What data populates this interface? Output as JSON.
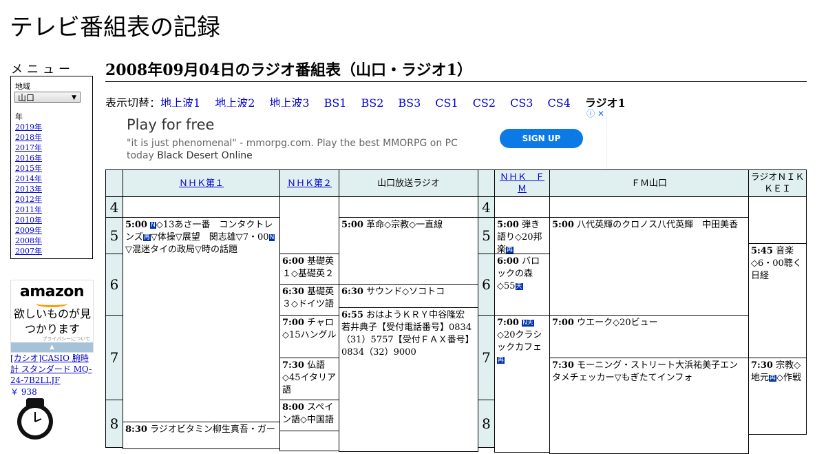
{
  "site_title": "テレビ番組表の記録",
  "menu": {
    "title": "メニュー",
    "region_label": "地域",
    "region_value": "山口",
    "year_label": "年",
    "years": [
      "2019年",
      "2018年",
      "2017年",
      "2016年",
      "2015年",
      "2014年",
      "2013年",
      "2012年",
      "2011年",
      "2010年",
      "2009年",
      "2008年",
      "2007年"
    ]
  },
  "amazon": {
    "logo": "amazon",
    "tagline": "欲しいものが見つかります",
    "privacy": "プライバシーについて",
    "product_title": "[カシオ]CASIO 腕時計 スタンダード MQ-24-7B2LLJF",
    "price": "￥ 938"
  },
  "page_heading": "2008年09月04日のラジオ番組表（山口・ラジオ1）",
  "switcher": {
    "label": "表示切替：",
    "links": [
      "地上波1",
      "地上波2",
      "地上波3",
      "BS1",
      "BS2",
      "BS3",
      "CS1",
      "CS2",
      "CS3",
      "CS4"
    ],
    "current": "ラジオ1"
  },
  "ad": {
    "title": "Play for free",
    "desc": "\"it is just phenomenal\" - mmorpg.com. Play the best MMORPG on PC today",
    "desc_bold": "Black Desert Online",
    "button": "SIGN UP",
    "icons": "ⓘ ✕"
  },
  "channels": [
    "ＮＨＫ第１",
    "ＮＨＫ第２",
    "山口放送ラジオ",
    "ＮＨＫ　ＦＭ",
    "ＦＭ山口",
    "ラジオＮＩＫＫＥＩ"
  ],
  "hours": [
    "4",
    "5",
    "6",
    "7",
    "8"
  ],
  "programs": {
    "nhk1_500": {
      "time": "5:00",
      "b1": "N",
      "t1": "◇13あさ一番　コンタクトレンズ",
      "b2": "再",
      "t2": "▽体操▽展望　関志雄▽7・00",
      "b3": "N",
      "t3": "▽混迷タイの政局▽時の話題"
    },
    "nhk1_830": {
      "time": "8:30",
      "text": "ラジオビタミン柳生真吾・ガー"
    },
    "nhk2_600": {
      "time": "6:00",
      "text": "基礎英１◇基礎英２"
    },
    "nhk2_630": {
      "time": "6:30",
      "text": "基礎英３◇ドイツ語"
    },
    "nhk2_700": {
      "time": "7:00",
      "text": "チャロ◇15ハングル"
    },
    "nhk2_730": {
      "time": "7:30",
      "text": "仏語◇45イタリア語"
    },
    "nhk2_800": {
      "time": "8:00",
      "text": "スペイン語◇中国語"
    },
    "kry_500": {
      "time": "5:00",
      "text": "革命◇宗教◇一直線"
    },
    "kry_630": {
      "time": "6:30",
      "text": "サウンド◇ソコトコ"
    },
    "kry_655": {
      "time": "6:55",
      "text": "おはようＫＲＹ中谷隆宏　若井典子【受付電話番号】0834（31）5757【受付ＦＡＸ番号】0834（32）9000"
    },
    "nhkfm_500": {
      "time": "5:00",
      "text": "弾き語り◇20邦楽",
      "b1": "再"
    },
    "nhkfm_600": {
      "time": "6:00",
      "text": "バロックの森◇55",
      "b1": "天"
    },
    "nhkfm_700": {
      "time": "7:00",
      "b1": "N天",
      "text": "◇20クラシックカフェ",
      "b2": "再"
    },
    "fmy_500": {
      "time": "5:00",
      "text": "八代英輝のクロノス八代英輝　中田美香"
    },
    "fmy_700": {
      "time": "7:00",
      "text": "ウエーク◇20ビュー"
    },
    "fmy_730": {
      "time": "7:30",
      "text": "モーニング・ストリート大浜祐美子エンタメチェッカー▽もぎたてインフォ"
    },
    "nikkei_545": {
      "time": "5:45",
      "text": "音楽◇6・00聴く日経"
    },
    "nikkei_730": {
      "time": "7:30",
      "text1": "宗教◇地元",
      "b1": "再",
      "text2": "◇作戦"
    }
  }
}
